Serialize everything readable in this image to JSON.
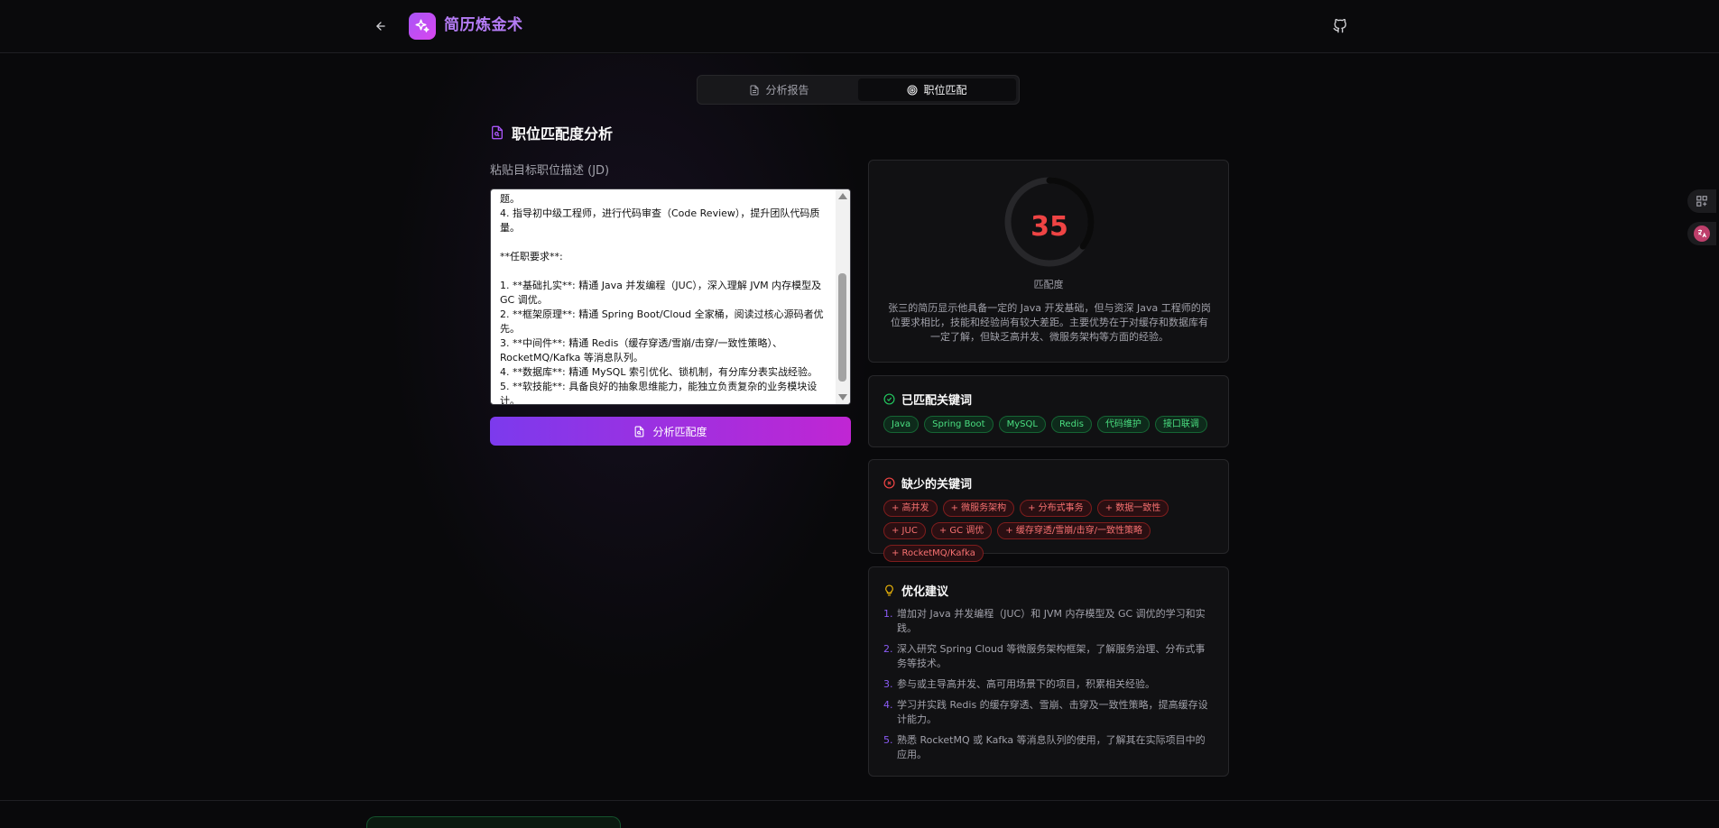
{
  "header": {
    "back_icon": "arrow-left-icon",
    "logo_icon": "sparkles-icon",
    "title": "简历炼金术",
    "github_icon": "github-icon"
  },
  "tabs": [
    {
      "label": "分析报告",
      "icon": "file-text-icon",
      "active": false
    },
    {
      "label": "职位匹配",
      "icon": "target-icon",
      "active": true
    }
  ],
  "jd_section": {
    "title": "职位匹配度分析",
    "input_label": "粘贴目标职位描述 (JD)",
    "jd_text": "题。\n4. 指导初中级工程师，进行代码审查（Code Review），提升团队代码质量。\n\n**任职要求**:\n\n1. **基础扎实**: 精通 Java 并发编程（JUC），深入理解 JVM 内存模型及 GC 调优。\n2. **框架原理**: 精通 Spring Boot/Cloud 全家桶，阅读过核心源码者优先。\n3. **中间件**: 精通 Redis（缓存穿透/雪崩/击穿/一致性策略）、RocketMQ/Kafka 等消息队列。\n4. **数据库**: 精通 MySQL 索引优化、锁机制，有分库分表实战经验。\n5. **软技能**: 具备良好的抽象思维能力，能独立负责复杂的业务模块设计。",
    "analyze_button": "分析匹配度"
  },
  "score": {
    "value": "35",
    "percent": 35,
    "label": "匹配度",
    "description": "张三的简历显示他具备一定的 Java 开发基础，但与资深 Java 工程师的岗位要求相比，技能和经验尚有较大差距。主要优势在于对缓存和数据库有一定了解，但缺乏高并发、微服务架构等方面的经验。",
    "color": "#ef4444"
  },
  "matched": {
    "title": "已匹配关键词",
    "keywords": [
      "Java",
      "Spring Boot",
      "MySQL",
      "Redis",
      "代码维护",
      "接口联调"
    ]
  },
  "missing": {
    "title": "缺少的关键词",
    "keywords": [
      "+ 高并发",
      "+ 微服务架构",
      "+ 分布式事务",
      "+ 数据一致性",
      "+ JUC",
      "+ GC 调优",
      "+ 缓存穿透/雪崩/击穿/一致性策略",
      "+ RocketMQ/Kafka"
    ]
  },
  "advice": {
    "title": "优化建议",
    "items": [
      {
        "num": "1.",
        "text": "增加对 Java 并发编程（JUC）和 JVM 内存模型及 GC 调优的学习和实践。"
      },
      {
        "num": "2.",
        "text": "深入研究 Spring Cloud 等微服务架构框架，了解服务治理、分布式事务等技术。"
      },
      {
        "num": "3.",
        "text": "参与或主导高并发、高可用场景下的项目，积累相关经验。"
      },
      {
        "num": "4.",
        "text": "学习并实践 Redis 的缓存穿透、雪崩、击穿及一致性策略，提高缓存设计能力。"
      },
      {
        "num": "5.",
        "text": "熟悉 RocketMQ 或 Kafka 等消息队列的使用，了解其在实际项目中的应用。"
      }
    ]
  }
}
